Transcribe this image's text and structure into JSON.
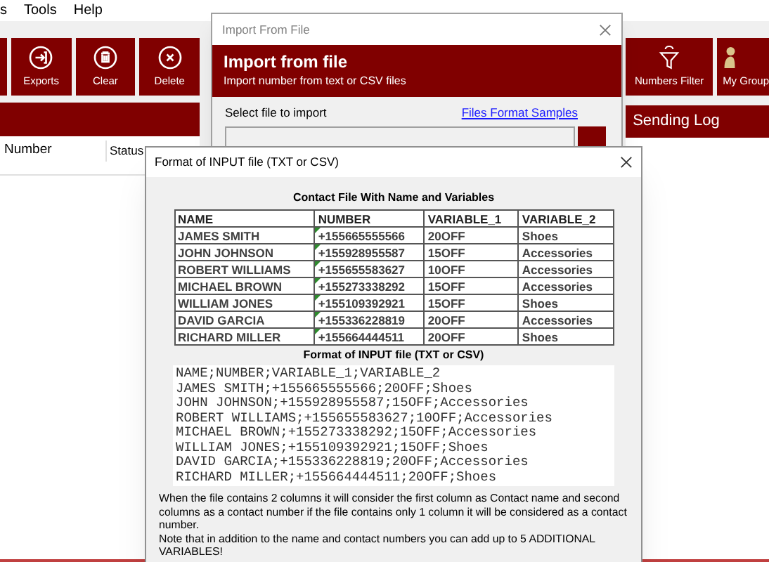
{
  "menu": [
    "s",
    "Tools",
    "Help"
  ],
  "toolbar": {
    "buttons": [
      "Exports",
      "Clear",
      "Delete"
    ]
  },
  "right_toolbar": {
    "buttons": [
      "Numbers Filter",
      "My Group"
    ],
    "panel_title": "Sending Log"
  },
  "table": {
    "columns": [
      "Number",
      "Status"
    ]
  },
  "import_dialog": {
    "title": "Import From File",
    "header_title": "Import from file",
    "header_subtitle": "Import number from text or CSV files",
    "field_label": "Select file to import",
    "link": "Files Format Samples"
  },
  "format_dialog": {
    "title": "Format of INPUT file (TXT or CSV)",
    "table_title": "Contact File With Name and Variables",
    "columns": [
      "NAME",
      "NUMBER",
      "VARIABLE_1",
      "VARIABLE_2"
    ],
    "rows": [
      [
        "JAMES SMITH",
        "+155665555566",
        "20OFF",
        "Shoes"
      ],
      [
        "JOHN JOHNSON",
        "+155928955587",
        "15OFF",
        "Accessories"
      ],
      [
        "ROBERT WILLIAMS",
        "+155655583627",
        "10OFF",
        "Accessories"
      ],
      [
        "MICHAEL BROWN",
        "+155273338292",
        "15OFF",
        "Accessories"
      ],
      [
        "WILLIAM JONES",
        "+155109392921",
        "15OFF",
        "Shoes"
      ],
      [
        "DAVID GARCIA",
        "+155336228819",
        "20OFF",
        "Accessories"
      ],
      [
        "RICHARD MILLER",
        "+155664444511",
        "20OFF",
        "Shoes"
      ]
    ],
    "format_title": "Format of INPUT file (TXT or CSV)",
    "code_lines": [
      "NAME;NUMBER;VARIABLE_1;VARIABLE_2",
      "JAMES SMITH;+155665555566;20OFF;Shoes",
      "JOHN JOHNSON;+155928955587;15OFF;Accessories",
      "ROBERT WILLIAMS;+155655583627;10OFF;Accessories",
      "MICHAEL BROWN;+155273338292;15OFF;Accessories",
      "WILLIAM JONES;+155109392921;15OFF;Shoes",
      "DAVID GARCIA;+155336228819;20OFF;Accessories",
      "RICHARD MILLER;+155664444511;20OFF;Shoes"
    ],
    "notes": [
      "When the file contains 2 columns it will consider the first column as Contact name and second columns as a contact number if the file contains only 1 column it will be considered as a contact number.",
      "Note that in addition to the name and contact numbers you can  add up to 5 ADDITIONAL VARIABLES!"
    ]
  }
}
